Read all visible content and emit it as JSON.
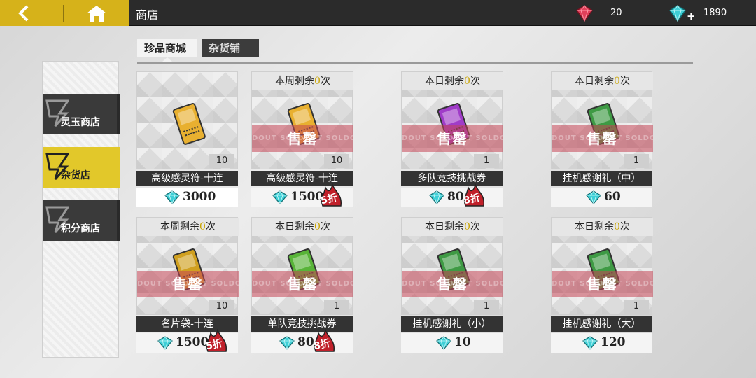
{
  "topbar": {
    "title": "商店",
    "back_icon": "back-arrow-icon",
    "home_icon": "home-icon",
    "currencies": [
      {
        "name": "red-gem",
        "amount": "20",
        "color": "#e0405a"
      },
      {
        "name": "cyan-gem",
        "amount": "1890",
        "color": "#3ecfd6"
      }
    ]
  },
  "tabs": [
    {
      "label": "珍品商城",
      "active": true
    },
    {
      "label": "杂货铺",
      "active": false
    }
  ],
  "sidebar": {
    "items": [
      {
        "label": "灵玉商店",
        "active": false
      },
      {
        "label": "杂货店",
        "active": true
      },
      {
        "label": "积分商店",
        "active": false
      }
    ]
  },
  "cards": [
    {
      "limit_prefix": "",
      "limit_count": "",
      "limit_suffix": "",
      "name": "高级感灵符-十连",
      "qty": "10",
      "price": "3000",
      "discount": "",
      "sold_out": false,
      "art_color": "#e8b030"
    },
    {
      "limit_prefix": "本周剩余",
      "limit_count": "0",
      "limit_suffix": "次",
      "name": "高级感灵符-十连",
      "qty": "10",
      "price": "1500",
      "discount": "5折",
      "sold_out": true,
      "art_color": "#e8b030"
    },
    {
      "limit_prefix": "本日剩余",
      "limit_count": "0",
      "limit_suffix": "次",
      "name": "多队竞技挑战券",
      "qty": "1",
      "price": "80",
      "discount": "8折",
      "sold_out": true,
      "art_color": "#a03cc8"
    },
    {
      "limit_prefix": "本日剩余",
      "limit_count": "0",
      "limit_suffix": "次",
      "name": "挂机感谢礼（中）",
      "qty": "1",
      "price": "60",
      "discount": "",
      "sold_out": true,
      "art_color": "#3e9a44"
    },
    {
      "limit_prefix": "本周剩余",
      "limit_count": "0",
      "limit_suffix": "次",
      "name": "名片袋-十连",
      "qty": "10",
      "price": "1500",
      "discount": "5折",
      "sold_out": true,
      "art_color": "#d0a020"
    },
    {
      "limit_prefix": "本日剩余",
      "limit_count": "0",
      "limit_suffix": "次",
      "name": "单队竞技挑战券",
      "qty": "1",
      "price": "80",
      "discount": "8折",
      "sold_out": true,
      "art_color": "#58b438"
    },
    {
      "limit_prefix": "本日剩余",
      "limit_count": "0",
      "limit_suffix": "次",
      "name": "挂机感谢礼（小）",
      "qty": "1",
      "price": "10",
      "discount": "",
      "sold_out": true,
      "art_color": "#3e9a44"
    },
    {
      "limit_prefix": "本日剩余",
      "limit_count": "0",
      "limit_suffix": "次",
      "name": "挂机感谢礼（大）",
      "qty": "1",
      "price": "120",
      "discount": "",
      "sold_out": true,
      "art_color": "#3e9a44"
    }
  ],
  "soldout_label": "售罄",
  "soldout_ghost": "DOUT SOLDOUT SOLDOUT SOLDOUT",
  "price_gem_color": "#3ecfd6"
}
